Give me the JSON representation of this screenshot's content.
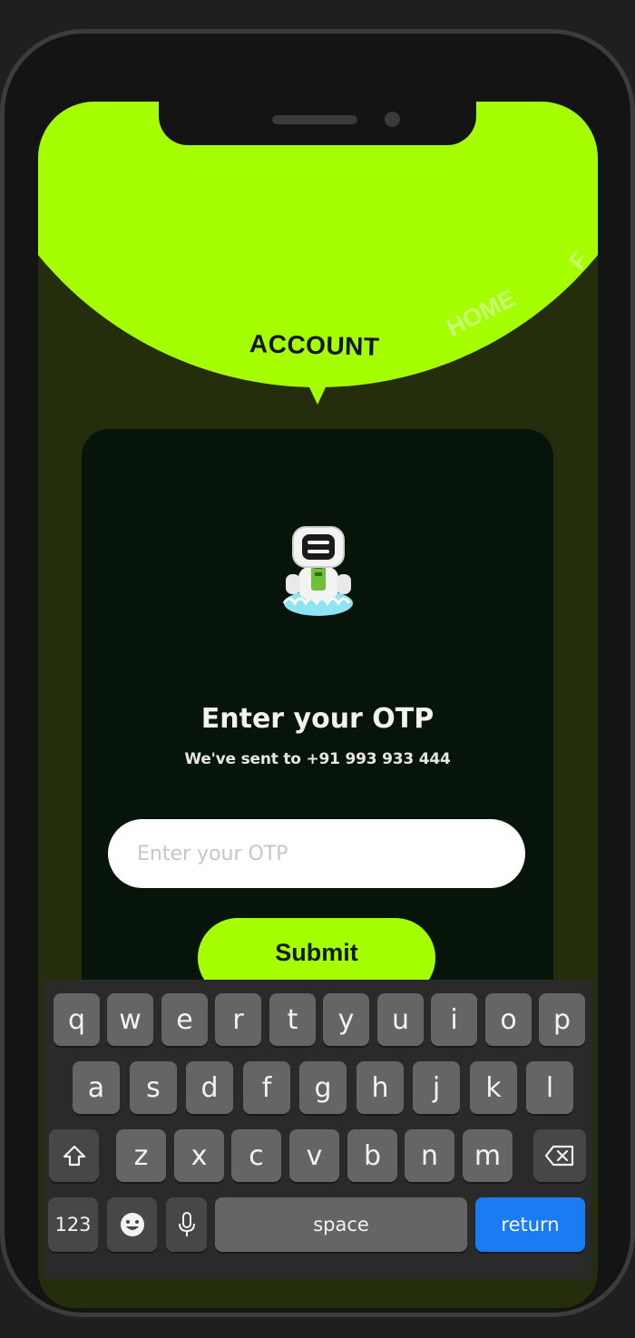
{
  "nav": {
    "active_tab": "ACCOUNT",
    "tabs": [
      "ACCOUNT",
      "HOME",
      "F"
    ]
  },
  "otp_card": {
    "title": "Enter your OTP",
    "subtitle": "We've sent to +91 993 933 444",
    "input_placeholder": "Enter your OTP",
    "submit_label": "Submit"
  },
  "keyboard": {
    "row1": [
      "q",
      "w",
      "e",
      "r",
      "t",
      "y",
      "u",
      "i",
      "o",
      "p"
    ],
    "row2": [
      "a",
      "s",
      "d",
      "f",
      "g",
      "h",
      "j",
      "k",
      "l"
    ],
    "row3": [
      "z",
      "x",
      "c",
      "v",
      "b",
      "n",
      "m"
    ],
    "numbers_label": "123",
    "space_label": "space",
    "return_label": "return",
    "icons": [
      "shift-icon",
      "delete-icon",
      "emoji-icon",
      "microphone-icon"
    ]
  },
  "colors": {
    "accent": "#a6ff00",
    "card_background": "#07140a",
    "screen_background": "#242e0c",
    "return_key": "#1a7cf2"
  }
}
